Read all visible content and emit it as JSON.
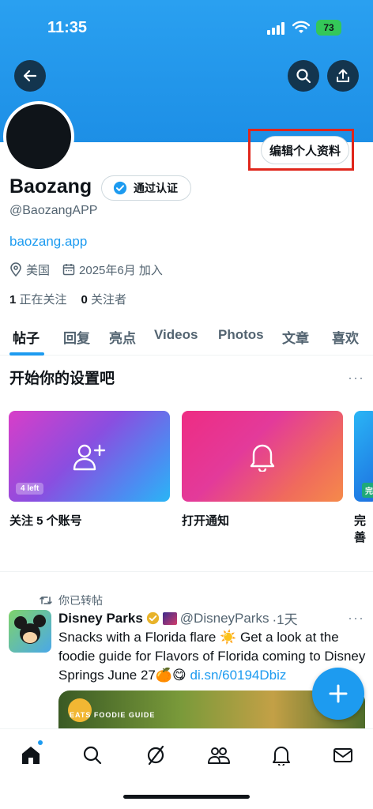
{
  "status_bar": {
    "time": "11:35",
    "battery": "73"
  },
  "profile": {
    "name": "Baozang",
    "handle": "@BaozangAPP",
    "verify_label": "通过认证",
    "edit_label": "编辑个人资料",
    "website": "baozang.app",
    "location": "美国",
    "joined": "2025年6月 加入",
    "following_count": "1",
    "following_label": "正在关注",
    "followers_count": "0",
    "followers_label": "关注者"
  },
  "tabs": [
    {
      "label": "帖子",
      "active": true
    },
    {
      "label": "回复"
    },
    {
      "label": "亮点"
    },
    {
      "label": "Videos"
    },
    {
      "label": "Photos"
    },
    {
      "label": "文章"
    },
    {
      "label": "喜欢"
    }
  ],
  "setup": {
    "title": "开始你的设置吧",
    "more": "···",
    "cards": [
      {
        "label": "关注 5 个账号",
        "badge": "4 left",
        "icon": "add-user-icon"
      },
      {
        "label": "打开通知",
        "icon": "bell-icon"
      },
      {
        "label": "完善",
        "badge": "完"
      }
    ]
  },
  "post": {
    "retweet_label": "你已转帖",
    "author_name": "Disney Parks",
    "author_handle": "@DisneyParks",
    "time": "·1天",
    "more": "···",
    "text_main": "Snacks with a Florida flare ☀️ Get a look at the foodie guide for Flavors of Florida coming to Disney Springs June 27🍊😋 ",
    "text_link": "di.sn/60194Dbiz",
    "image_tag": "EATS  FOODIE GUIDE"
  },
  "colors": {
    "accent": "#1d9bf0",
    "banner": "#1d8fe6",
    "highlight_box": "#e0261b"
  }
}
